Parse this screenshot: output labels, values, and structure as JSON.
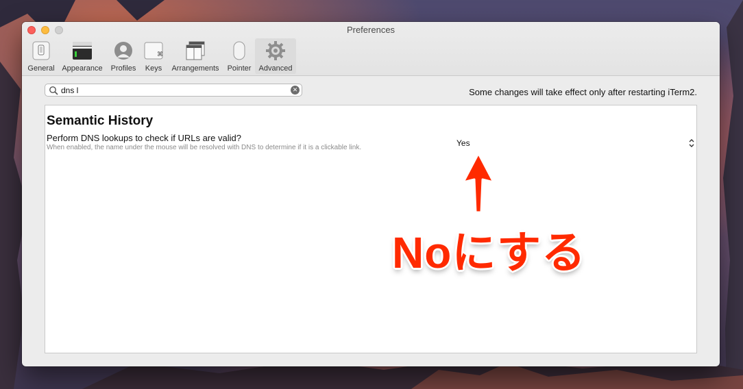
{
  "window": {
    "title": "Preferences"
  },
  "toolbar": {
    "items": [
      {
        "label": "General",
        "icon": "phone-icon",
        "active": false
      },
      {
        "label": "Appearance",
        "icon": "appearance-icon",
        "active": false
      },
      {
        "label": "Profiles",
        "icon": "user-icon",
        "active": false
      },
      {
        "label": "Keys",
        "icon": "keyboard-key-icon",
        "active": false
      },
      {
        "label": "Arrangements",
        "icon": "windows-icon",
        "active": false
      },
      {
        "label": "Pointer",
        "icon": "mouse-icon",
        "active": false
      },
      {
        "label": "Advanced",
        "icon": "gear-icon",
        "active": true
      }
    ]
  },
  "search": {
    "value": "dns l"
  },
  "notice": "Some changes will take effect only after restarting iTerm2.",
  "section": {
    "title": "Semantic History",
    "option_label": "Perform DNS lookups to check if URLs are valid?",
    "option_description": "When enabled, the name under the mouse will be resolved with DNS to determine if it is a clickable link.",
    "option_value": "Yes"
  },
  "annotation": {
    "text": "Noにする",
    "color": "#ff2a00"
  }
}
